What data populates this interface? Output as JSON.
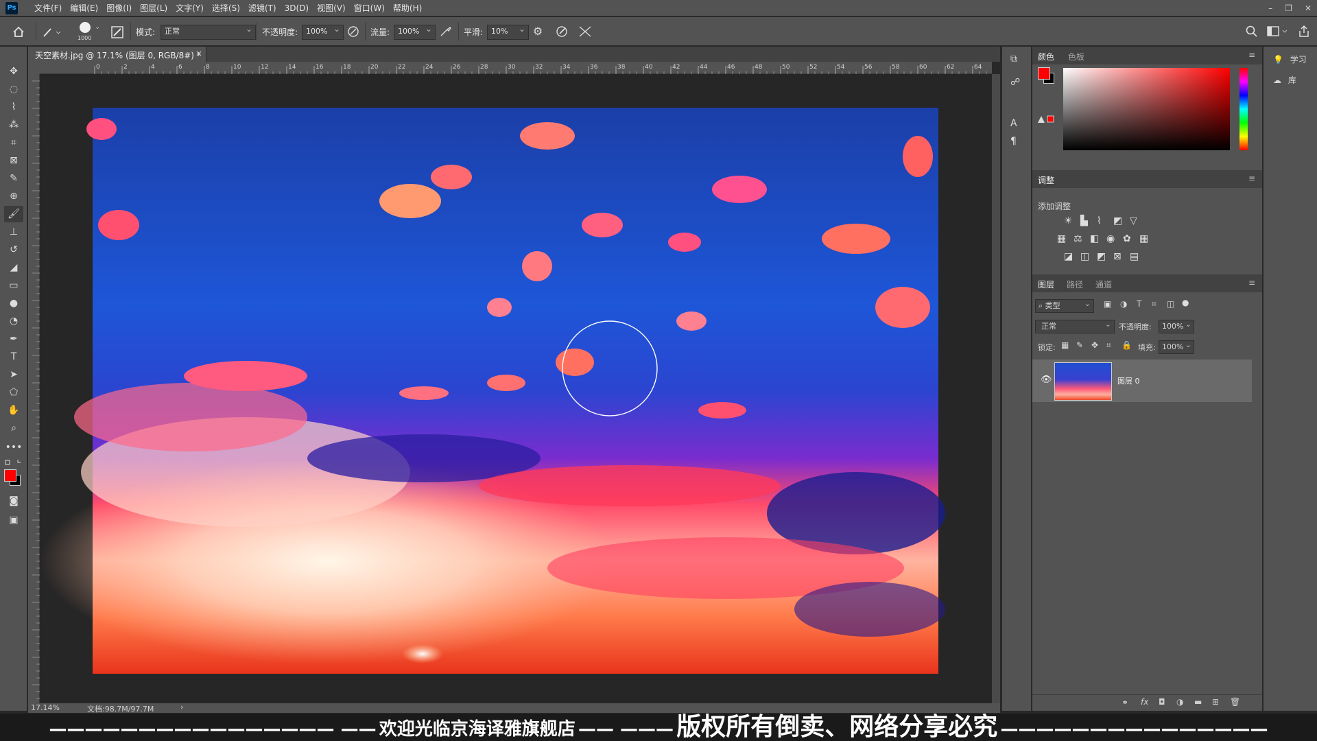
{
  "app": {
    "logo": "Ps"
  },
  "menu": [
    "文件(F)",
    "编辑(E)",
    "图像(I)",
    "图层(L)",
    "文字(Y)",
    "选择(S)",
    "滤镜(T)",
    "3D(D)",
    "视图(V)",
    "窗口(W)",
    "帮助(H)"
  ],
  "options": {
    "brush_size": "1000",
    "mode_label": "模式:",
    "mode_value": "正常",
    "opacity_label": "不透明度:",
    "opacity_value": "100%",
    "flow_label": "流量:",
    "flow_value": "100%",
    "smooth_label": "平滑:",
    "smooth_value": "10%"
  },
  "document": {
    "tab_title": "天空素材.jpg @ 17.1% (图层 0, RGB/8#) *",
    "close": "×"
  },
  "ruler_h": [
    "0",
    "2",
    "4",
    "6",
    "8",
    "10",
    "12",
    "14",
    "16",
    "18",
    "20",
    "22",
    "24",
    "26",
    "28",
    "30",
    "32",
    "34",
    "36",
    "38",
    "40",
    "42",
    "44",
    "46",
    "48",
    "50",
    "52",
    "54",
    "56",
    "58",
    "60",
    "62",
    "64"
  ],
  "status": {
    "zoom": "17.14%",
    "doc": "文档:98.7M/97.7M",
    "arrow": "›"
  },
  "color_panel": {
    "tab1": "颜色",
    "tab2": "色板"
  },
  "adjust_panel": {
    "title": "调整",
    "subtitle": "添加调整"
  },
  "layers_panel": {
    "tab1": "图层",
    "tab2": "路径",
    "tab3": "通道",
    "filter_label": "类型",
    "blend_mode": "正常",
    "opacity_label": "不透明度:",
    "opacity_value": "100%",
    "lock_label": "锁定:",
    "fill_label": "填充:",
    "fill_value": "100%",
    "layer_name": "图层 0"
  },
  "far_panel": {
    "learn": "学习",
    "library": "库"
  },
  "watermark": {
    "dashes_left": "———————————————— ——",
    "part1": "欢迎光临京海译雅旗舰店",
    "dashes_mid": "—— ———",
    "part2": "版权所有倒卖、网络分享必究",
    "dashes_right": "———————————————"
  },
  "colors": {
    "foreground": "#ff0000",
    "background": "#000000",
    "ui": "#535353",
    "canvas_bg": "#262626"
  }
}
